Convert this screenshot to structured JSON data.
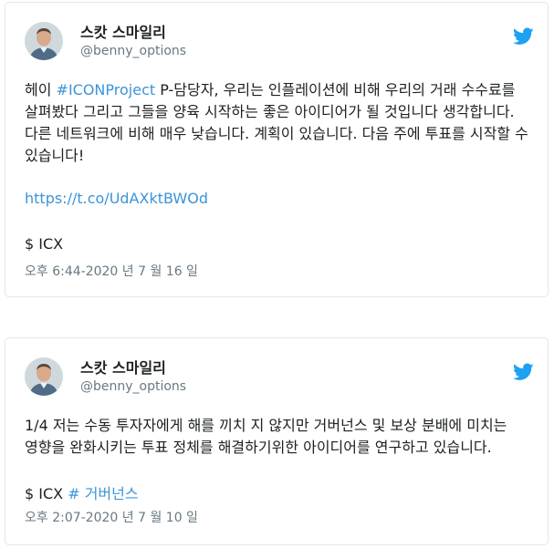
{
  "brand": {
    "link_color": "#3b94d9",
    "twitter_blue": "#1da1f2",
    "meta_color": "#697882"
  },
  "tweets": [
    {
      "author": {
        "name": "스캇 스마일리",
        "handle": "@benny_options",
        "avatar_icon": "avatar-photo"
      },
      "text_lines": {
        "prefix": "헤이 ",
        "hashtag": "#ICONProject",
        "body": " P-담당자, 우리는 인플레이션에 비해 우리의 거래 수수료를 살펴봤다 그리고 그들을 양육 시작하는 좋은 아이디어가 될 것입니다 생각합니다. 다른 네트워크에 비해 매우 낮습니다. 계획이 있습니다. 다음 주에 투표를 시작할 수 있습니다!"
      },
      "link": "https://t.co/UdAXktBWOd",
      "cashtag": "$ ICX",
      "timestamp": "오후 6:44-2020 년 7 월 16 일",
      "icon": "twitter-bird-icon"
    },
    {
      "author": {
        "name": "스캇 스마일리",
        "handle": "@benny_options",
        "avatar_icon": "avatar-photo"
      },
      "text": "1/4 저는 수동 투자자에게 해를 끼치 지 않지만 거버넌스 및 보상 분배에 미치는 영향을 완화시키는 투표 정체를 해결하기위한 아이디어를 연구하고 있습니다.",
      "cashtag": "$ ICX",
      "hashtag": "# 거버넌스",
      "timestamp": "오후 2:07-2020 년 7 월 10 일",
      "icon": "twitter-bird-icon"
    }
  ]
}
